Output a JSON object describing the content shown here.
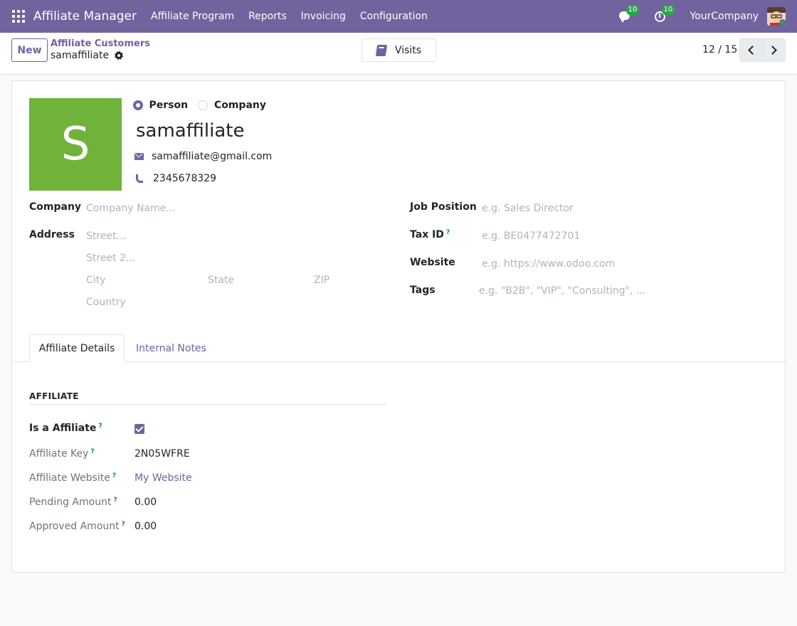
{
  "navbar": {
    "brand": "Affiliate Manager",
    "menu": [
      "Affiliate Program",
      "Reports",
      "Invoicing",
      "Configuration"
    ],
    "messages_count": "10",
    "activities_count": "10",
    "company": "YourCompany"
  },
  "control": {
    "new_label": "New",
    "breadcrumb_parent": "Affiliate Customers",
    "breadcrumb_current": "samaffiliate",
    "visits_label": "Visits",
    "pager": "12 / 15"
  },
  "partner": {
    "avatar_letter": "S",
    "avatar_color": "#6fb33b",
    "type_options": [
      "Person",
      "Company"
    ],
    "type_selected": "Person",
    "name": "samaffiliate",
    "email": "samaffiliate@gmail.com",
    "phone": "2345678329"
  },
  "form": {
    "company_label": "Company",
    "company_placeholder": "Company Name...",
    "address_label": "Address",
    "street_placeholder": "Street...",
    "street2_placeholder": "Street 2...",
    "city_placeholder": "City",
    "state_placeholder": "State",
    "zip_placeholder": "ZIP",
    "country_placeholder": "Country",
    "job_label": "Job Position",
    "job_placeholder": "e.g. Sales Director",
    "tax_label": "Tax ID",
    "tax_placeholder": "e.g. BE0477472701",
    "website_label": "Website",
    "website_placeholder": "e.g. https://www.odoo.com",
    "tags_label": "Tags",
    "tags_placeholder": "e.g. \"B2B\", \"VIP\", \"Consulting\", ..."
  },
  "tabs": [
    "Affiliate Details",
    "Internal Notes"
  ],
  "affiliate": {
    "section_title": "AFFILIATE",
    "is_affiliate_label": "Is a Affiliate",
    "is_affiliate": true,
    "key_label": "Affiliate Key",
    "key_value": "2N05WFRE",
    "website_label": "Affiliate Website",
    "website_value": "My Website",
    "pending_label": "Pending Amount",
    "pending_value": "0.00",
    "approved_label": "Approved Amount",
    "approved_value": "0.00"
  },
  "help_mark": "?",
  "colors": {
    "brand": "#71639e",
    "badge": "#28a745",
    "link": "#71639e"
  }
}
